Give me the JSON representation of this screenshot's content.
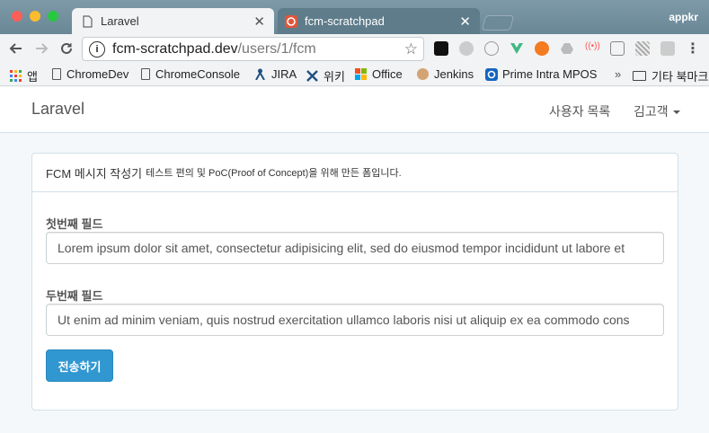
{
  "browser": {
    "tabs": [
      {
        "title": "Laravel",
        "active": true
      },
      {
        "title": "fcm-scratchpad",
        "active": false
      }
    ],
    "profile_name": "appkr",
    "url_host": "fcm-scratchpad.dev",
    "url_path": "/users/1/fcm",
    "bookmarks": [
      {
        "label": "앱",
        "icon": "apps-grid-icon"
      },
      {
        "label": "ChromeDev",
        "icon": "document-icon"
      },
      {
        "label": "ChromeConsole",
        "icon": "document-icon"
      },
      {
        "label": "JIRA",
        "icon": "jira-icon"
      },
      {
        "label": "위키",
        "icon": "wiki-icon"
      },
      {
        "label": "Office",
        "icon": "office-icon"
      },
      {
        "label": "Jenkins",
        "icon": "jenkins-icon"
      },
      {
        "label": "Prime Intra MPOS",
        "icon": "prime-icon"
      }
    ],
    "overflow_label": "»",
    "other_bookmarks_label": "기타 북마크"
  },
  "app": {
    "brand": "Laravel",
    "nav": {
      "user_list_label": "사용자 목록",
      "user_name": "김고객"
    }
  },
  "panel": {
    "title": "FCM 메시지 작성기",
    "subtitle": "테스트 편의 및 PoC(Proof of Concept)을 위해 만든 폼입니다.",
    "fields": [
      {
        "label": "첫번째 필드",
        "value": "Lorem ipsum dolor sit amet, consectetur adipisicing elit, sed do eiusmod tempor incididunt ut labore et"
      },
      {
        "label": "두번째 필드",
        "value": "Ut enim ad minim veniam, quis nostrud exercitation ullamco laboris nisi ut aliquip ex ea commodo cons"
      }
    ],
    "submit_label": "전송하기"
  },
  "colors": {
    "primary": "#3097d1",
    "page_bg": "#f5f8fa",
    "border": "#d3e0e9"
  }
}
